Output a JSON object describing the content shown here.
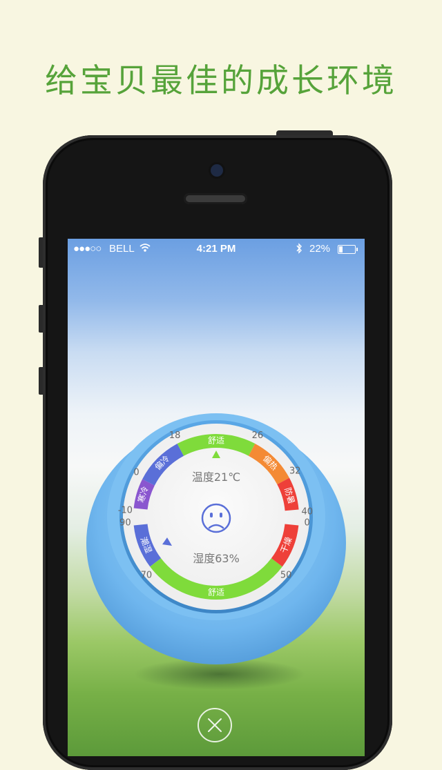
{
  "headline": "给宝贝最佳的成长环境",
  "status_bar": {
    "carrier": "BELL",
    "time": "4:21 PM",
    "battery_percent": "22%",
    "battery_level": 0.22,
    "signal_dots": "●●●○○",
    "icons": [
      "wifi-icon",
      "bluetooth-icon",
      "battery-icon"
    ]
  },
  "thermometer": {
    "temp_reading": "温度21℃",
    "humidity_reading": "湿度63%",
    "mood_icon": "sad-face-icon",
    "temp_scale_labels": [
      "-10",
      "0",
      "18",
      "26",
      "32",
      "40"
    ],
    "humidity_scale_labels": [
      "90",
      "70",
      "50",
      "0"
    ],
    "temp_zones": [
      "寒冷",
      "偏冷",
      "舒适",
      "偏热",
      "防暑"
    ],
    "humidity_zones": [
      "潮湿",
      "舒适",
      "干燥"
    ],
    "colors": {
      "cold": "#8a56cf",
      "cool": "#5a6fd8",
      "comfort": "#7fdb3b",
      "warm": "#f48a34",
      "hot": "#ee4039",
      "humid": "#5a6fd8",
      "dry": "#ee4039",
      "body": "#6fb6ee",
      "face": "#f5f5f5"
    }
  },
  "close_icon": "close-icon"
}
